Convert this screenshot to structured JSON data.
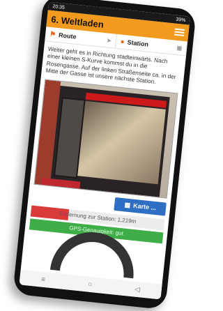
{
  "status": {
    "time": "20:35",
    "battery": "39%"
  },
  "header": {
    "title": "6. Weltladen"
  },
  "tabs": [
    {
      "label": "Route",
      "icon": "signpost-icon"
    },
    {
      "label": "Station",
      "icon": "map-pin-icon"
    }
  ],
  "description": "Weiter geht es in Richtung stadteinwärts. Nach einer kleinen S-Kurve kommst du in die Rosengasse. Auf der linken Straßenseite ca. in der Mitte der Gasse ist unsere nächste Station.",
  "map_button": {
    "label": "Karte ..."
  },
  "distance": {
    "label": "Entfernung zur Station: 1,219m",
    "progress": 0.28
  },
  "gps": {
    "label": "GPS-Genauigkeit: gut"
  },
  "colors": {
    "accent": "#f29a1d",
    "map_button": "#2e6fc4",
    "gps": "#3fae49",
    "distance_bar": "#d93b3b"
  }
}
